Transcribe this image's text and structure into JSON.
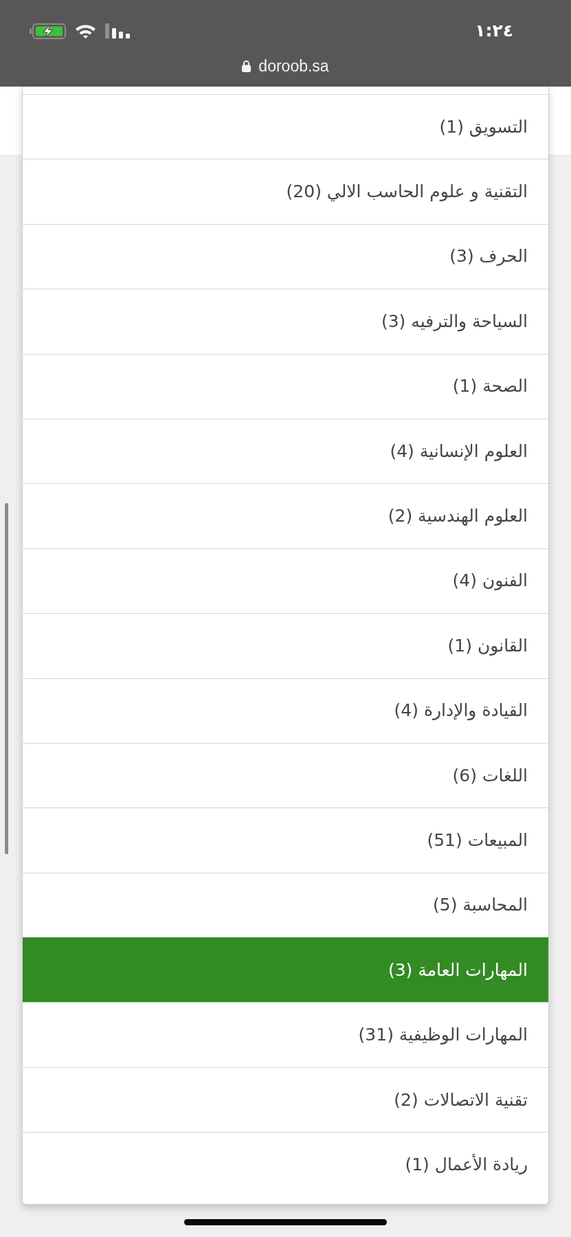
{
  "status_bar": {
    "time": "١:٢٤"
  },
  "address_bar": {
    "url": "doroob.sa"
  },
  "dropdown": {
    "items": [
      {
        "label": "التسويق (1)",
        "selected": false
      },
      {
        "label": "التقنية و علوم الحاسب الالي (20)",
        "selected": false
      },
      {
        "label": "الحرف (3)",
        "selected": false
      },
      {
        "label": "السياحة والترفيه (3)",
        "selected": false
      },
      {
        "label": "الصحة (1)",
        "selected": false
      },
      {
        "label": "العلوم الإنسانية (4)",
        "selected": false
      },
      {
        "label": "العلوم الهندسية (2)",
        "selected": false
      },
      {
        "label": "الفنون (4)",
        "selected": false
      },
      {
        "label": "القانون (1)",
        "selected": false
      },
      {
        "label": "القيادة والإدارة (4)",
        "selected": false
      },
      {
        "label": "اللغات (6)",
        "selected": false
      },
      {
        "label": "المبيعات (51)",
        "selected": false
      },
      {
        "label": "المحاسبة (5)",
        "selected": false
      },
      {
        "label": "المهارات العامة (3)",
        "selected": true
      },
      {
        "label": "المهارات الوظيفية (31)",
        "selected": false
      },
      {
        "label": "تقنية الاتصالات (2)",
        "selected": false
      },
      {
        "label": "ريادة الأعمال (1)",
        "selected": false
      }
    ]
  }
}
